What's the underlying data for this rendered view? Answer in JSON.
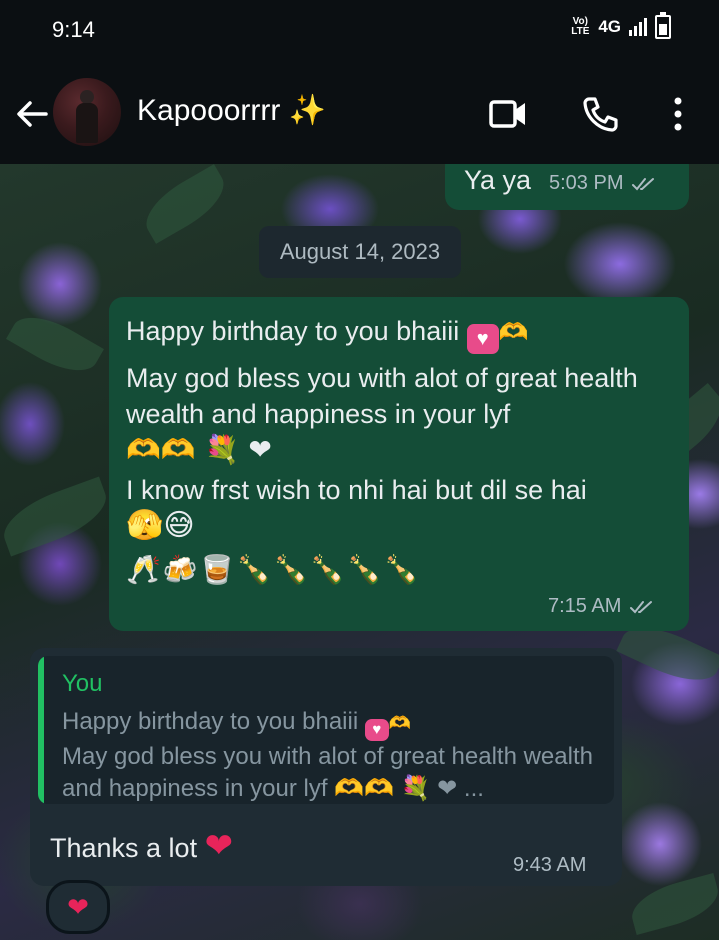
{
  "status_bar": {
    "time": "9:14",
    "volte": "Vo) LTE",
    "network": "4G"
  },
  "header": {
    "contact_name": "Kapooorrrr ✨"
  },
  "chat": {
    "prev_message": {
      "text": "Ya ya",
      "time": "5:03 PM"
    },
    "date_chip": "August 14, 2023",
    "outgoing_message": {
      "lines": [
        "Happy birthday to you bhaiii",
        "May god bless you with alot of great health wealth and happiness in your lyf",
        "I know frst wish to nhi hai but dil se hai"
      ],
      "emoji_heart_box": "♥",
      "emoji_hands": "🫶",
      "emoji_line_2": "🫶🫶 💐 ❤",
      "emoji_line_3": "🫣😅",
      "emoji_line_4": "🥂🍻🥃🍾🍾🍾🍾🍾",
      "time": "7:15 AM"
    },
    "reply_message": {
      "quote_author": "You",
      "quote_line_1": "Happy birthday to you bhaiii",
      "quote_line_2": "May god bless you with alot of great health wealth and happiness in your lyf",
      "quote_emoji": "🫶🫶 💐 ❤ ...",
      "text": "Thanks a lot",
      "text_emoji": "❤",
      "time": "9:43 AM"
    },
    "reaction": "❤"
  },
  "colors": {
    "header_bg": "#0b0f12",
    "outgoing_bubble": "#144d37",
    "incoming_bubble": "#1f2c34",
    "accent_green": "#21c063",
    "heart_red": "#e8245a"
  },
  "icons": [
    "back-arrow-icon",
    "video-call-icon",
    "phone-icon",
    "more-options-icon",
    "double-check-icon"
  ]
}
